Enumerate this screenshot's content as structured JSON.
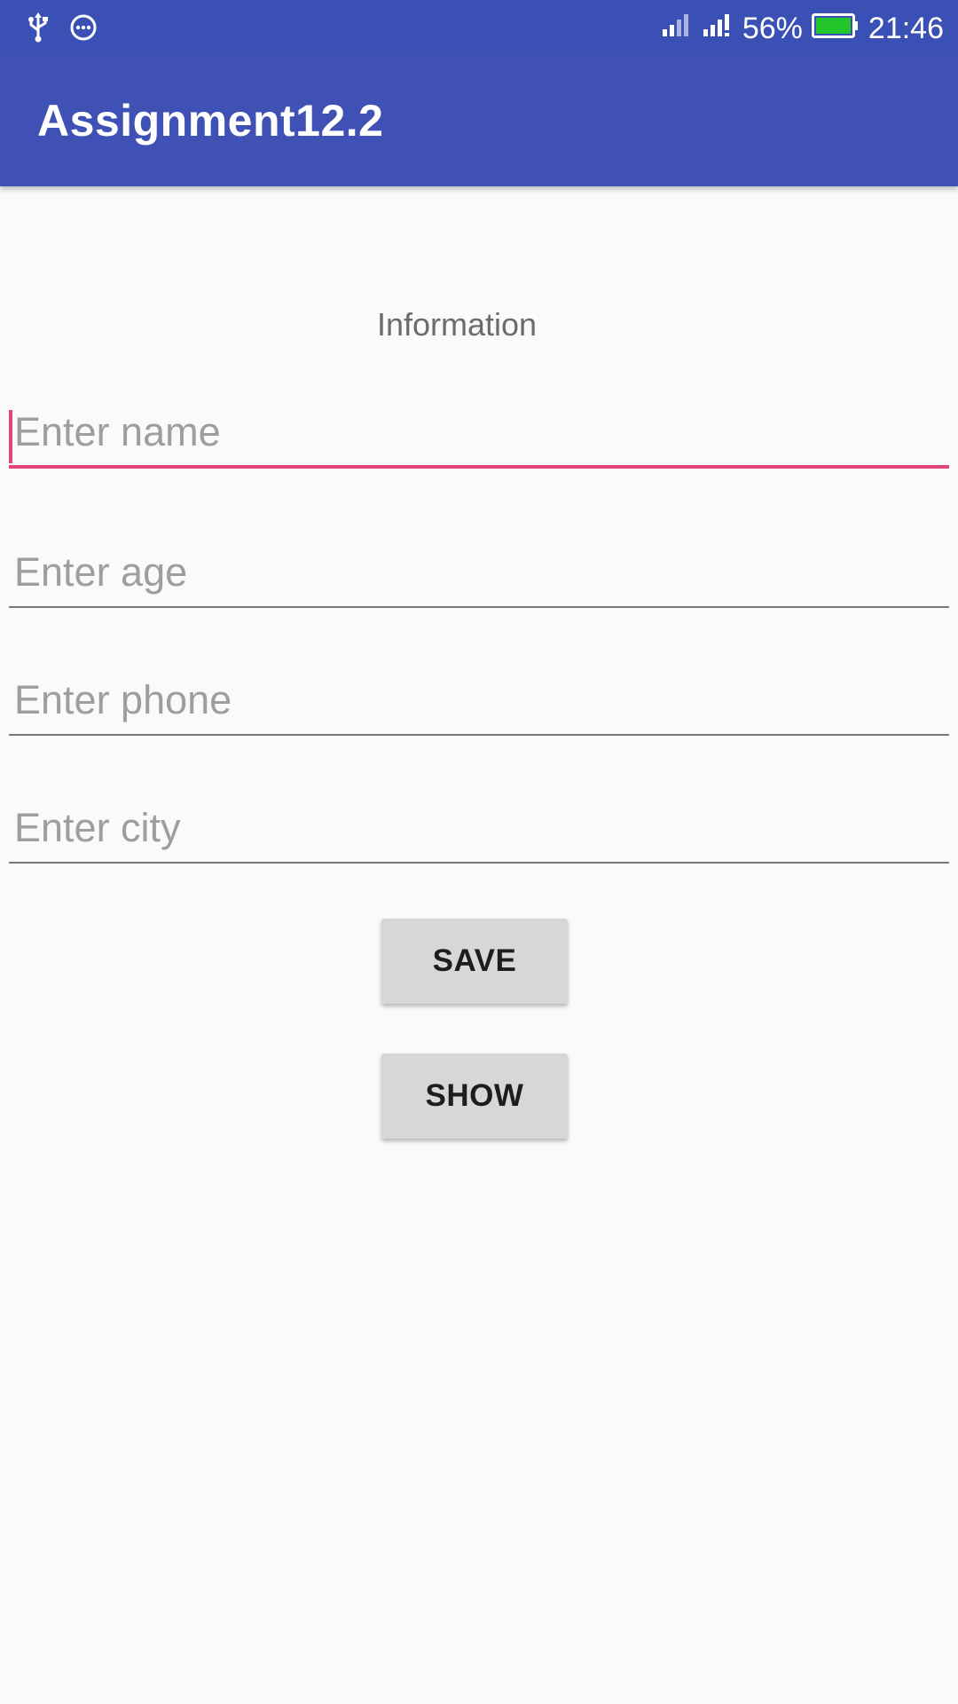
{
  "status_bar": {
    "battery_percent": "56%",
    "time": "21:46",
    "background_color": "#3a50b4",
    "battery_fill_color": "#22c52a",
    "left_icons": [
      "usb-icon",
      "more-dots-icon"
    ],
    "right_icons": [
      "signal-sim1-icon",
      "signal-sim2-icon",
      "battery-icon"
    ]
  },
  "app_bar": {
    "title": "Assignment12.2",
    "background_color": "#3f51b5"
  },
  "form": {
    "heading": "Information",
    "fields": [
      {
        "placeholder": "Enter name",
        "value": ""
      },
      {
        "placeholder": "Enter age",
        "value": ""
      },
      {
        "placeholder": "Enter phone",
        "value": ""
      },
      {
        "placeholder": "Enter city",
        "value": ""
      }
    ],
    "accent_color": "#e0457b"
  },
  "buttons": {
    "save_label": "SAVE",
    "show_label": "SHOW"
  }
}
